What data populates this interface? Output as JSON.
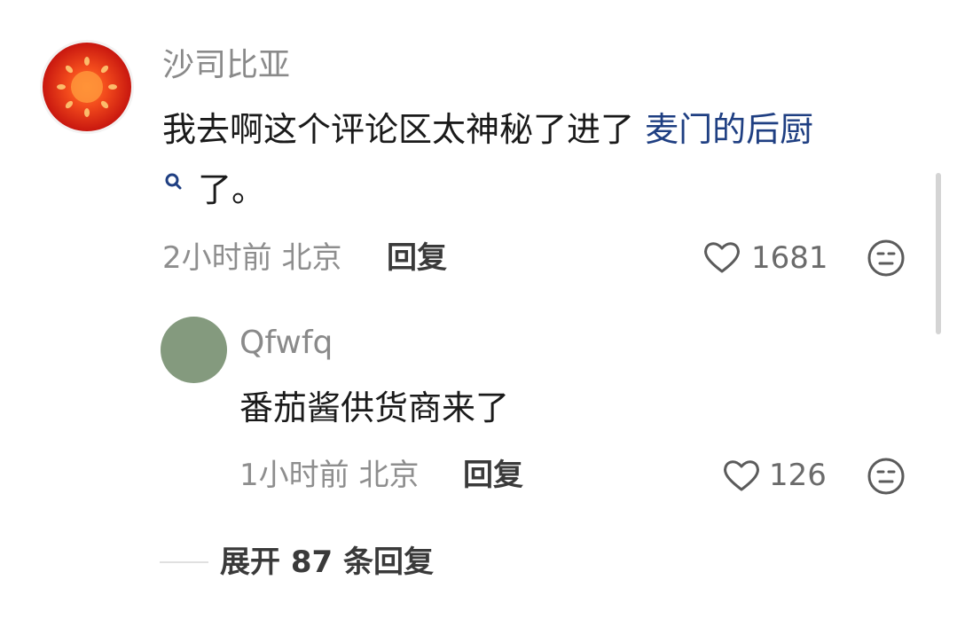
{
  "comment": {
    "author": "沙司比亚",
    "text_part1": "我去啊这个评论区太神秘了进了 ",
    "link_text": "麦门的后厨",
    "text_part2": "了。",
    "time": "2小时前",
    "location": "北京",
    "reply_label": "回复",
    "like_count": "1681"
  },
  "reply": {
    "author": "Qfwfq",
    "text": "番茄酱供货商来了",
    "time": "1小时前",
    "location": "北京",
    "reply_label": "回复",
    "like_count": "126"
  },
  "expand": {
    "label": "展开 87 条回复"
  },
  "colors": {
    "link": "#1f3f82",
    "meta_gray": "#8e8e8e",
    "reply_avatar": "#849a7e",
    "tomato_red": "#e8301c"
  },
  "icons": {
    "like": "heart-outline-icon",
    "dislike": "neutral-face-icon",
    "link_search": "search-icon"
  }
}
